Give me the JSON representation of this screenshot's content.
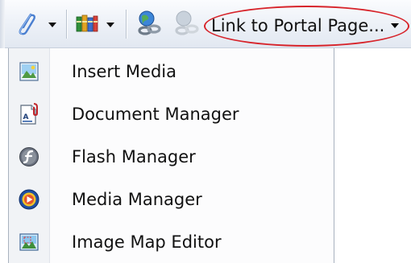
{
  "toolbar": {
    "buttons": [
      {
        "icon": "paperclip-icon"
      },
      {
        "icon": "books-icon"
      },
      {
        "icon": "hyperlink-icon"
      },
      {
        "icon": "remove-hyperlink-icon"
      }
    ],
    "link_dropdown_label": "Link to Portal Page...",
    "highlight_color": "#d7242b"
  },
  "menu": {
    "items": [
      {
        "label": "Insert Media",
        "icon": "insert-media-icon"
      },
      {
        "label": "Document Manager",
        "icon": "document-manager-icon"
      },
      {
        "label": "Flash Manager",
        "icon": "flash-manager-icon"
      },
      {
        "label": "Media Manager",
        "icon": "media-manager-icon"
      },
      {
        "label": "Image Map Editor",
        "icon": "image-map-editor-icon"
      }
    ]
  }
}
